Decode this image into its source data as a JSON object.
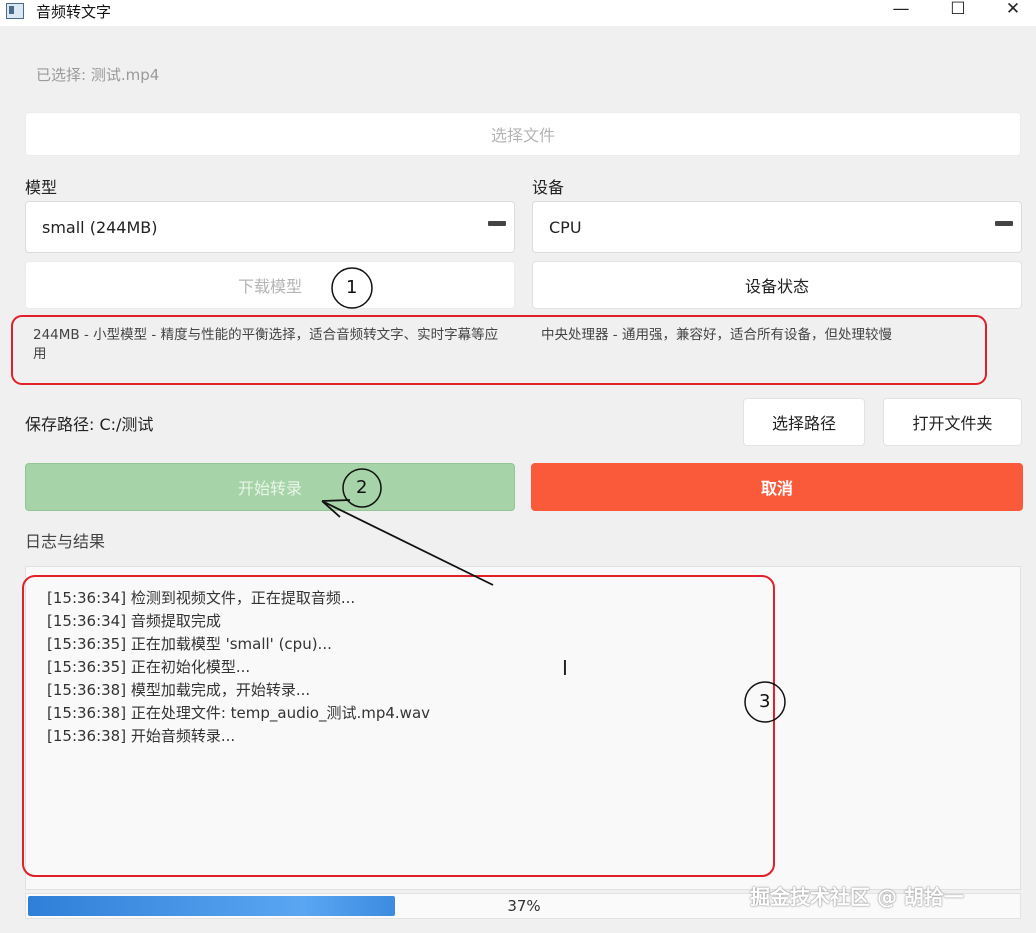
{
  "window": {
    "title": "音频转文字",
    "minimize_glyph": "—",
    "maximize_glyph": "☐",
    "close_glyph": "✕",
    "icon": "app-icon"
  },
  "file": {
    "selected_label": "已选择: 测试.mp4",
    "select_button": "选择文件"
  },
  "model": {
    "label": "模型",
    "selected": "small (244MB)",
    "download_button": "下载模型",
    "description": "244MB - 小型模型 - 精度与性能的平衡选择，适合音频转文字、实时字幕等应用"
  },
  "device": {
    "label": "设备",
    "selected": "CPU",
    "status_button": "设备状态",
    "description": "中央处理器 - 通用强，兼容好，适合所有设备，但处理较慢"
  },
  "save": {
    "label": "保存路径: C:/测试",
    "choose_path_button": "选择路径",
    "open_folder_button": "打开文件夹"
  },
  "actions": {
    "start_button": "开始转录",
    "cancel_button": "取消"
  },
  "log": {
    "label": "日志与结果",
    "lines": [
      "[15:36:34] 检测到视频文件，正在提取音频...",
      "[15:36:34] 音频提取完成",
      "[15:36:35] 正在加载模型 'small' (cpu)...",
      "[15:36:35] 正在初始化模型...",
      "[15:36:38] 模型加载完成，开始转录...",
      "[15:36:38] 正在处理文件: temp_audio_测试.mp4.wav",
      "[15:36:38] 开始音频转录..."
    ]
  },
  "progress": {
    "value": 0.37,
    "text": "37%"
  },
  "annotations": {
    "marker_1": "1",
    "marker_2": "2",
    "marker_3": "3",
    "stroke_color": "#e0202a"
  },
  "watermark": "掘金技术社区 @ 胡拾一",
  "colors": {
    "start_bg": "#a6d3a8",
    "cancel_bg": "#fa5a3a",
    "progress_fill": "#3b8be0"
  }
}
